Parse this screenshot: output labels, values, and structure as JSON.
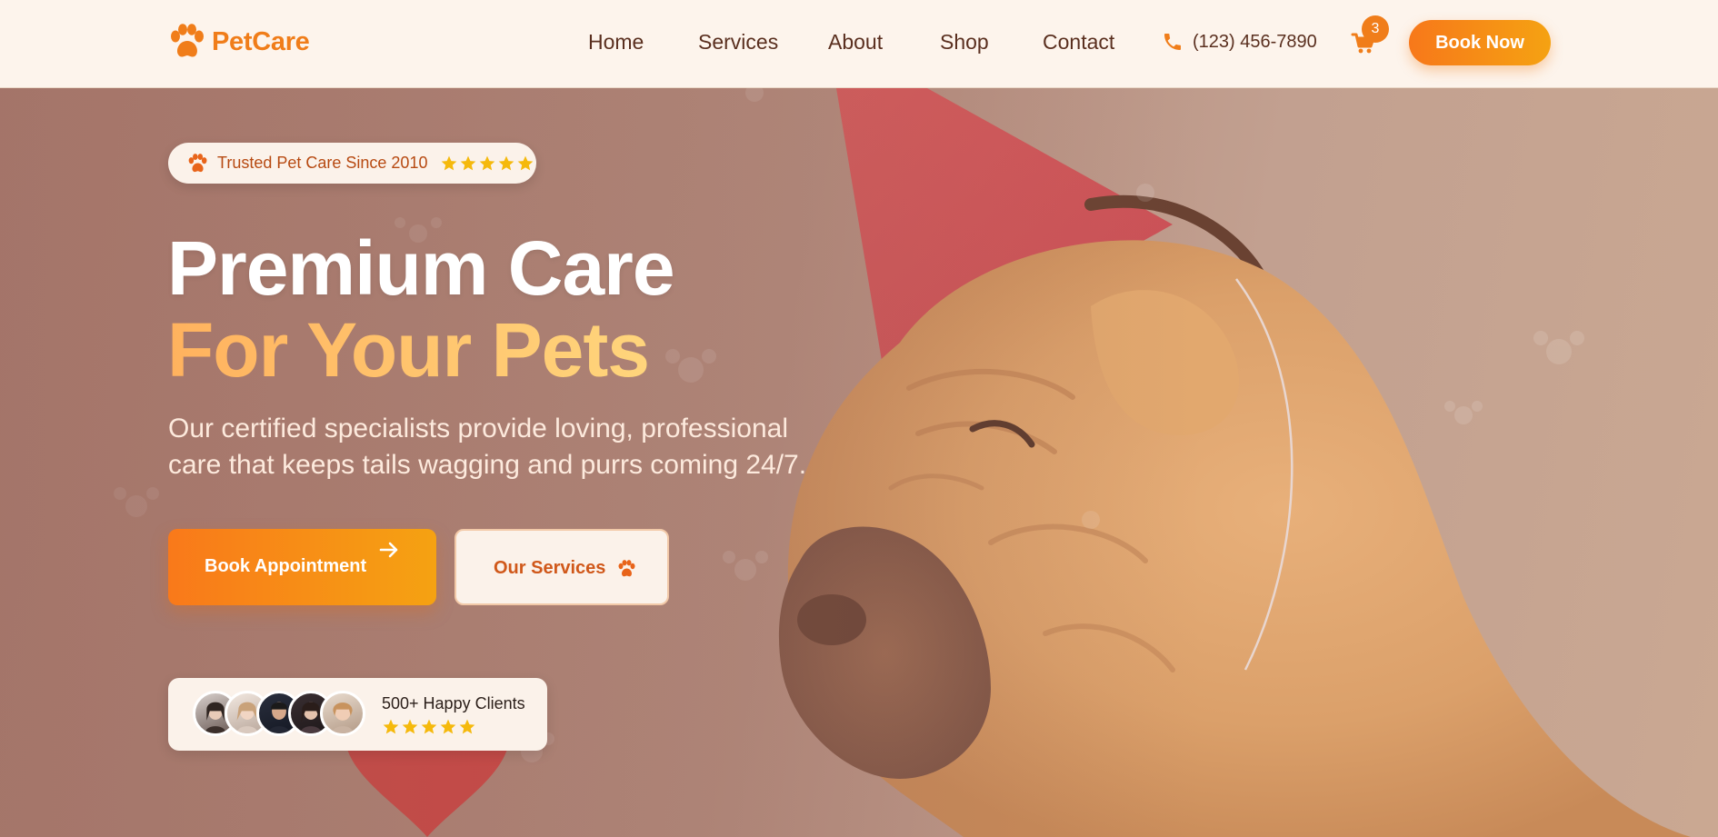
{
  "brand": {
    "name": "PetCare",
    "logo_icon": "paw-icon",
    "color": "#f07d1a"
  },
  "nav": {
    "links": [
      "Home",
      "Services",
      "About",
      "Shop",
      "Contact"
    ],
    "phone": "(123) 456-7890",
    "phone_icon": "phone-icon",
    "cart_icon": "cart-icon",
    "cart_count": "3",
    "cta": "Book Now"
  },
  "hero": {
    "badge_text": "Trusted Pet Care Since 2010",
    "badge_rating_stars": 5,
    "headline_line1": "Premium Care",
    "headline_line2": "For Your Pets",
    "subtext": "Our certified specialists provide loving, professional care that keeps tails wagging and purrs coming 24/7.",
    "primary_button": "Book Appointment",
    "primary_button_icon": "arrow-right-icon",
    "secondary_button": "Our Services",
    "secondary_button_icon": "paw-icon",
    "clients_text": "500+ Happy Clients",
    "clients_rating_stars": 5,
    "avatar_count": 5
  },
  "colors": {
    "accent": "#f07d1a",
    "accent_light": "#f5a212",
    "nav_bg": "#fdf4ec",
    "nav_text": "#5a2f1f",
    "star": "#f5b90c"
  }
}
